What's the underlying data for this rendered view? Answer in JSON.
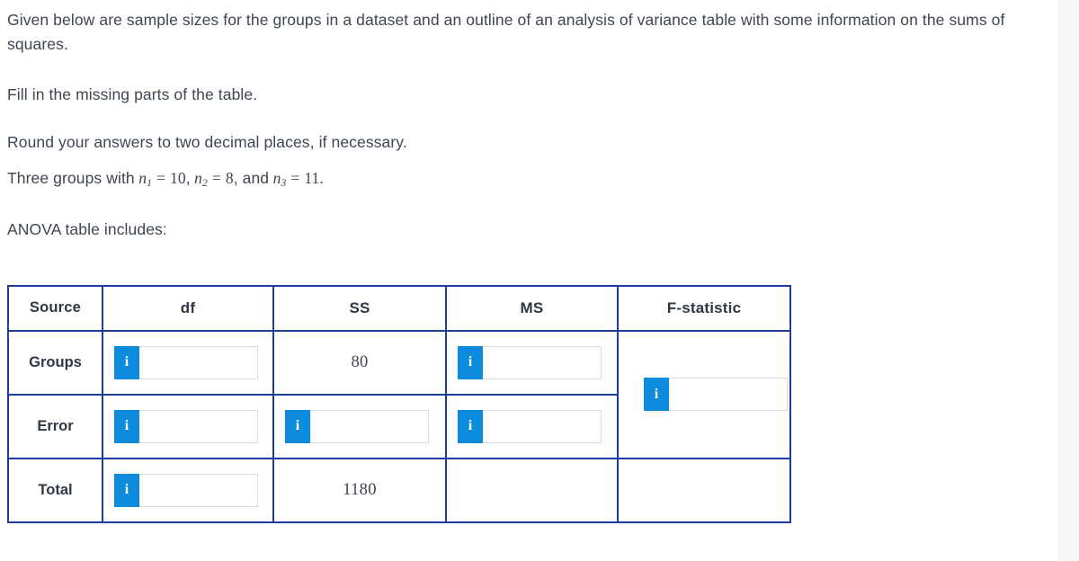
{
  "prompt": {
    "intro": "Given below are sample sizes for the groups in a dataset and an outline of an analysis of variance table with some information on the sums of squares.",
    "instruction": "Fill in the missing parts of the table.",
    "rounding": "Round your answers to two decimal places, if necessary.",
    "groups_lead": "Three groups with",
    "group_sizes": [
      {
        "symbol": "n",
        "sub": "1",
        "value": "10"
      },
      {
        "symbol": "n",
        "sub": "2",
        "value": "8"
      },
      {
        "symbol": "n",
        "sub": "3",
        "value": "11"
      }
    ],
    "sep_comma": ",",
    "sep_and": ", and",
    "period": ".",
    "equals": "=",
    "table_lead": "ANOVA table includes:"
  },
  "table": {
    "headers": {
      "source": "Source",
      "df": "df",
      "ss": "SS",
      "ms": "MS",
      "f": "F-statistic"
    },
    "rows": [
      {
        "label": "Groups",
        "df": {
          "type": "input",
          "value": ""
        },
        "ss": {
          "type": "value",
          "value": "80"
        },
        "ms": {
          "type": "input",
          "value": ""
        }
      },
      {
        "label": "Error",
        "df": {
          "type": "input",
          "value": ""
        },
        "ss": {
          "type": "input",
          "value": ""
        },
        "ms": {
          "type": "input",
          "value": ""
        }
      },
      {
        "label": "Total",
        "df": {
          "type": "input",
          "value": ""
        },
        "ss": {
          "type": "value",
          "value": "1180"
        }
      }
    ],
    "fstatistic": {
      "type": "input",
      "value": ""
    },
    "info_glyph": "i",
    "colors": {
      "border": "#1f3d9e",
      "info_blue": "#0d8bdc",
      "text": "#3e4652"
    }
  }
}
